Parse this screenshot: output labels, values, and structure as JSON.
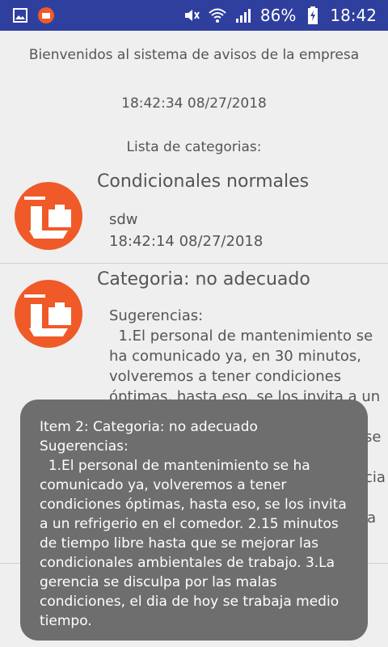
{
  "status_bar": {
    "battery": "86%",
    "time": "18:42",
    "icons": [
      "gallery-icon",
      "app-notification-icon",
      "mute-icon",
      "wifi-icon",
      "signal-icon",
      "battery-charging-icon"
    ]
  },
  "header": {
    "welcome": "Bienvenidos al sistema de avisos de la empresa",
    "datetime": "18:42:34 08/27/2018",
    "list_title": "Lista de categorias:"
  },
  "categories": [
    {
      "title": "Condicionales normales",
      "subtitle": "sdw",
      "timestamp": "18:42:14 08/27/2018"
    },
    {
      "title": "Categoria: no adecuado",
      "body": "Sugerencias:\n  1.El personal de mantenimiento se ha comunicado ya, en 30 minutos, volveremos a tener condiciones óptimas, hasta eso, se los invita a un refrigerio en el comedor. 2.15 minutos de tiempo libre hasta que se mejorar las condicionales ambientales de trabajo. 3.La gerencia se disculpa por las malas condiciones, el dia de hoy se trabaja medio tiempo."
    }
  ],
  "toast": {
    "text": "Item 2: Categoria: no adecuado\nSugerencias:\n  1.El personal de mantenimiento se ha comunicado ya, volveremos a tener condiciones óptimas, hasta eso, se los invita a un refrigerio en el comedor. 2.15 minutos de tiempo libre hasta que se mejorar las condicionales ambientales de trabajo. 3.La gerencia se disculpa por las malas condiciones, el dia de hoy se trabaja medio tiempo."
  },
  "colors": {
    "status_bar": "#2f3f9e",
    "avatar": "#f05a28",
    "toast": "#6e6e6e"
  }
}
